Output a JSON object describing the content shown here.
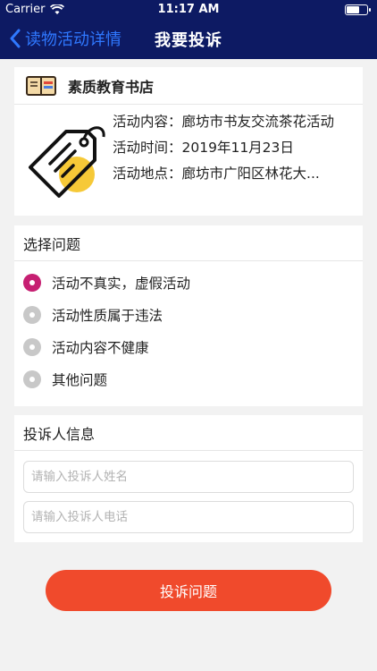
{
  "status_bar": {
    "carrier": "Carrier",
    "time": "11:17 AM"
  },
  "nav": {
    "back_label": "读物活动详情",
    "title": "我要投诉"
  },
  "store": {
    "name": "素质教育书店",
    "content_label": "活动内容：",
    "content_value": "廊坊市书友交流茶花活动",
    "time_label": "活动时间：",
    "time_value": "2019年11月23日",
    "location_label": "活动地点：",
    "location_value": "廊坊市广阳区林花大..."
  },
  "issues": {
    "title": "选择问题",
    "options": [
      {
        "label": "活动不真实，虚假活动",
        "selected": true
      },
      {
        "label": "活动性质属于违法",
        "selected": false
      },
      {
        "label": "活动内容不健康",
        "selected": false
      },
      {
        "label": "其他问题",
        "selected": false
      }
    ]
  },
  "complainant": {
    "title": "投诉人信息",
    "name_placeholder": "请输入投诉人姓名",
    "phone_placeholder": "请输入投诉人电话"
  },
  "submit_label": "投诉问题",
  "colors": {
    "nav_bg": "#0d1a63",
    "accent": "#f04a2c",
    "radio_selected": "#c61f72",
    "back_link": "#2f78ff"
  }
}
